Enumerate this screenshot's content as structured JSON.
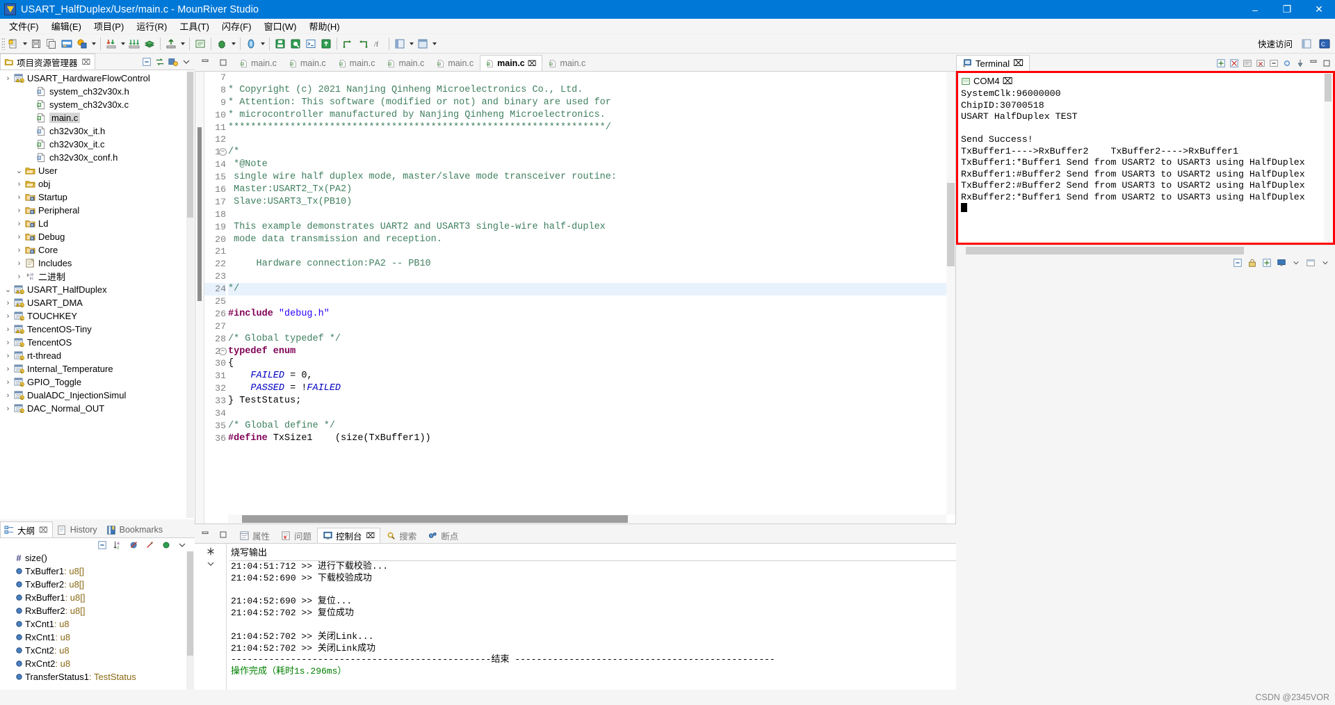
{
  "window": {
    "title": "USART_HalfDuplex/User/main.c - MounRiver Studio",
    "minimize": "–",
    "maximize": "❐",
    "close": "✕"
  },
  "menubar": {
    "items": [
      "文件(F)",
      "编辑(E)",
      "项目(P)",
      "运行(R)",
      "工具(T)",
      "闪存(F)",
      "窗口(W)",
      "帮助(H)"
    ]
  },
  "toolbar": {
    "quick_access": "快速访问"
  },
  "project_explorer": {
    "tab_label": "项目资源管理器",
    "close": "⌧",
    "tree": [
      {
        "indent": 0,
        "expander": "›",
        "icon": "project-icon",
        "label": "DAC_Normal_OUT",
        "selected": false
      },
      {
        "indent": 0,
        "expander": "›",
        "icon": "project-icon",
        "label": "DualADC_InjectionSimul",
        "selected": false
      },
      {
        "indent": 0,
        "expander": "›",
        "icon": "project-icon",
        "label": "GPIO_Toggle",
        "selected": false
      },
      {
        "indent": 0,
        "expander": "›",
        "icon": "project-icon",
        "label": "Internal_Temperature",
        "selected": false
      },
      {
        "indent": 0,
        "expander": "›",
        "icon": "project-icon",
        "label": "rt-thread",
        "selected": false
      },
      {
        "indent": 0,
        "expander": "›",
        "icon": "project-icon",
        "label": "TencentOS",
        "selected": false
      },
      {
        "indent": 0,
        "expander": "›",
        "icon": "project-warn-icon",
        "label": "TencentOS-Tiny",
        "selected": false
      },
      {
        "indent": 0,
        "expander": "›",
        "icon": "project-icon",
        "label": "TOUCHKEY",
        "selected": false
      },
      {
        "indent": 0,
        "expander": "›",
        "icon": "project-warn-icon",
        "label": "USART_DMA",
        "selected": false
      },
      {
        "indent": 0,
        "expander": "⌄",
        "icon": "project-warn-icon",
        "label": "USART_HalfDuplex",
        "selected": false
      },
      {
        "indent": 1,
        "expander": "›",
        "icon": "binaries-icon",
        "label": "二进制",
        "selected": false
      },
      {
        "indent": 1,
        "expander": "›",
        "icon": "includes-icon",
        "label": "Includes",
        "selected": false
      },
      {
        "indent": 1,
        "expander": "›",
        "icon": "srcfolder-icon",
        "label": "Core",
        "selected": false
      },
      {
        "indent": 1,
        "expander": "›",
        "icon": "srcfolder-icon",
        "label": "Debug",
        "selected": false
      },
      {
        "indent": 1,
        "expander": "›",
        "icon": "srcfolder-icon",
        "label": "Ld",
        "selected": false
      },
      {
        "indent": 1,
        "expander": "›",
        "icon": "srcfolder-icon",
        "label": "Peripheral",
        "selected": false
      },
      {
        "indent": 1,
        "expander": "›",
        "icon": "srcfolder-icon",
        "label": "Startup",
        "selected": false
      },
      {
        "indent": 1,
        "expander": "›",
        "icon": "folder-icon",
        "label": "obj",
        "selected": false
      },
      {
        "indent": 1,
        "expander": "⌄",
        "icon": "folder-icon",
        "label": "User",
        "selected": false
      },
      {
        "indent": 2,
        "expander": "",
        "icon": "header-file-icon",
        "label": "ch32v30x_conf.h",
        "selected": false
      },
      {
        "indent": 2,
        "expander": "",
        "icon": "c-file-icon",
        "label": "ch32v30x_it.c",
        "selected": false
      },
      {
        "indent": 2,
        "expander": "",
        "icon": "header-file-icon",
        "label": "ch32v30x_it.h",
        "selected": false
      },
      {
        "indent": 2,
        "expander": "",
        "icon": "c-file-icon",
        "label": "main.c",
        "selected": true
      },
      {
        "indent": 2,
        "expander": "",
        "icon": "c-file-icon",
        "label": "system_ch32v30x.c",
        "selected": false
      },
      {
        "indent": 2,
        "expander": "",
        "icon": "header-file-icon",
        "label": "system_ch32v30x.h",
        "selected": false
      },
      {
        "indent": 0,
        "expander": "›",
        "icon": "project-warn-icon",
        "label": "USART_HardwareFlowControl",
        "selected": false
      }
    ]
  },
  "outline": {
    "tabs": [
      {
        "label": "大纲",
        "active": true,
        "icon": "outline-icon"
      },
      {
        "label": "History",
        "active": false,
        "icon": "history-icon"
      },
      {
        "label": "Bookmarks",
        "active": false,
        "icon": "bookmark-icon"
      }
    ],
    "close": "⌧",
    "items": [
      {
        "icon": "define-icon",
        "name": "size()",
        "type": ""
      },
      {
        "icon": "var-icon",
        "name": "TxBuffer1",
        "type": " : u8[]"
      },
      {
        "icon": "var-icon",
        "name": "TxBuffer2",
        "type": " : u8[]"
      },
      {
        "icon": "var-icon",
        "name": "RxBuffer1",
        "type": " : u8[]"
      },
      {
        "icon": "var-icon",
        "name": "RxBuffer2",
        "type": " : u8[]"
      },
      {
        "icon": "var-icon",
        "name": "TxCnt1",
        "type": " : u8"
      },
      {
        "icon": "var-icon",
        "name": "RxCnt1",
        "type": " : u8"
      },
      {
        "icon": "var-icon",
        "name": "TxCnt2",
        "type": " : u8"
      },
      {
        "icon": "var-icon",
        "name": "RxCnt2",
        "type": " : u8"
      },
      {
        "icon": "var-icon",
        "name": "TransferStatus1",
        "type": " : TestStatus"
      }
    ]
  },
  "editor": {
    "tabs": [
      {
        "label": "main.c",
        "active": false
      },
      {
        "label": "main.c",
        "active": false
      },
      {
        "label": "main.c",
        "active": false
      },
      {
        "label": "main.c",
        "active": false
      },
      {
        "label": "main.c",
        "active": false
      },
      {
        "label": "main.c",
        "active": true
      },
      {
        "label": "main.c",
        "active": false
      }
    ],
    "active_tab_close": "⌧",
    "lines": [
      {
        "num": 7,
        "fold": "",
        "highlight": false,
        "tokens": [
          {
            "t": " ",
            "c": "pl"
          }
        ]
      },
      {
        "num": 8,
        "fold": "",
        "highlight": false,
        "tokens": [
          {
            "t": "* Copyright (c) 2021 Nanjing Qinheng Microelectronics Co., Ltd.",
            "c": "cmt"
          }
        ]
      },
      {
        "num": 9,
        "fold": "",
        "highlight": false,
        "tokens": [
          {
            "t": "* Attention: This software (modified or not) and binary are used for",
            "c": "cmt"
          }
        ]
      },
      {
        "num": 10,
        "fold": "",
        "highlight": false,
        "tokens": [
          {
            "t": "* microcontroller manufactured by Nanjing Qinheng Microelectronics.",
            "c": "cmt"
          }
        ]
      },
      {
        "num": 11,
        "fold": "",
        "highlight": false,
        "tokens": [
          {
            "t": "*******************************************************************/",
            "c": "cmt"
          }
        ]
      },
      {
        "num": 12,
        "fold": "",
        "highlight": false,
        "tokens": [
          {
            "t": "",
            "c": "pl"
          }
        ]
      },
      {
        "num": 13,
        "fold": "⊖",
        "highlight": false,
        "tokens": [
          {
            "t": "/*",
            "c": "cmt"
          }
        ]
      },
      {
        "num": 14,
        "fold": "",
        "highlight": false,
        "tokens": [
          {
            "t": " *@Note",
            "c": "cmt"
          }
        ]
      },
      {
        "num": 15,
        "fold": "",
        "highlight": false,
        "tokens": [
          {
            "t": " single wire half duplex mode, master/slave mode transceiver routine:",
            "c": "cmt"
          }
        ]
      },
      {
        "num": 16,
        "fold": "",
        "highlight": false,
        "tokens": [
          {
            "t": " Master:USART2_Tx(PA2)",
            "c": "cmt"
          }
        ]
      },
      {
        "num": 17,
        "fold": "",
        "highlight": false,
        "tokens": [
          {
            "t": " Slave:USART3_Tx(PB10)",
            "c": "cmt"
          }
        ]
      },
      {
        "num": 18,
        "fold": "",
        "highlight": false,
        "tokens": [
          {
            "t": "",
            "c": "pl"
          }
        ]
      },
      {
        "num": 19,
        "fold": "",
        "highlight": false,
        "tokens": [
          {
            "t": " This example demonstrates UART2 and USART3 single-wire half-duplex",
            "c": "cmt"
          }
        ]
      },
      {
        "num": 20,
        "fold": "",
        "highlight": false,
        "tokens": [
          {
            "t": " mode data transmission and reception.",
            "c": "cmt"
          }
        ]
      },
      {
        "num": 21,
        "fold": "",
        "highlight": false,
        "tokens": [
          {
            "t": "",
            "c": "pl"
          }
        ]
      },
      {
        "num": 22,
        "fold": "",
        "highlight": false,
        "tokens": [
          {
            "t": "     Hardware connection:PA2 -- PB10",
            "c": "cmt"
          }
        ]
      },
      {
        "num": 23,
        "fold": "",
        "highlight": false,
        "tokens": [
          {
            "t": "",
            "c": "pl"
          }
        ]
      },
      {
        "num": 24,
        "fold": "",
        "highlight": true,
        "tokens": [
          {
            "t": "*/",
            "c": "cmt"
          }
        ]
      },
      {
        "num": 25,
        "fold": "",
        "highlight": false,
        "tokens": [
          {
            "t": "",
            "c": "pl"
          }
        ]
      },
      {
        "num": 26,
        "fold": "",
        "highlight": false,
        "tokens": [
          {
            "t": "#include ",
            "c": "pre"
          },
          {
            "t": "\"debug.h\"",
            "c": "str"
          }
        ]
      },
      {
        "num": 27,
        "fold": "",
        "highlight": false,
        "tokens": [
          {
            "t": "",
            "c": "pl"
          }
        ]
      },
      {
        "num": 28,
        "fold": "",
        "highlight": false,
        "tokens": [
          {
            "t": "/* Global typedef */",
            "c": "cmt"
          }
        ]
      },
      {
        "num": 29,
        "fold": "⊖",
        "highlight": false,
        "tokens": [
          {
            "t": "typedef enum",
            "c": "kw"
          }
        ]
      },
      {
        "num": 30,
        "fold": "",
        "highlight": false,
        "tokens": [
          {
            "t": "{",
            "c": "pl"
          }
        ]
      },
      {
        "num": 31,
        "fold": "",
        "highlight": false,
        "tokens": [
          {
            "t": "    ",
            "c": "pl"
          },
          {
            "t": "FAILED",
            "c": "en"
          },
          {
            "t": " = 0,",
            "c": "pl"
          }
        ]
      },
      {
        "num": 32,
        "fold": "",
        "highlight": false,
        "tokens": [
          {
            "t": "    ",
            "c": "pl"
          },
          {
            "t": "PASSED",
            "c": "en"
          },
          {
            "t": " = !",
            "c": "pl"
          },
          {
            "t": "FAILED",
            "c": "en"
          }
        ]
      },
      {
        "num": 33,
        "fold": "",
        "highlight": false,
        "tokens": [
          {
            "t": "} TestStatus;",
            "c": "pl"
          }
        ]
      },
      {
        "num": 34,
        "fold": "",
        "highlight": false,
        "tokens": [
          {
            "t": "",
            "c": "pl"
          }
        ]
      },
      {
        "num": 35,
        "fold": "",
        "highlight": false,
        "tokens": [
          {
            "t": "/* Global define */",
            "c": "cmt"
          }
        ]
      },
      {
        "num": 36,
        "fold": "",
        "highlight": false,
        "tokens": [
          {
            "t": "#define ",
            "c": "pre"
          },
          {
            "t": "TxSize1    (size(TxBuffer1))",
            "c": "pl"
          }
        ]
      }
    ]
  },
  "console": {
    "tabs": [
      {
        "label": "属性",
        "active": false,
        "icon": "properties-icon"
      },
      {
        "label": "问题",
        "active": false,
        "icon": "problems-icon"
      },
      {
        "label": "控制台",
        "active": true,
        "icon": "console-icon"
      },
      {
        "label": "搜索",
        "active": false,
        "icon": "search-icon"
      },
      {
        "label": "断点",
        "active": false,
        "icon": "breakpoint-icon"
      }
    ],
    "active_close": "⌧",
    "header": "烧写输出",
    "lines": [
      {
        "text": "21:04:51:712 >> 进行下载校验...",
        "green": false
      },
      {
        "text": "21:04:52:690 >> 下载校验成功",
        "green": false
      },
      {
        "text": "",
        "green": false
      },
      {
        "text": "21:04:52:690 >> 复位...",
        "green": false
      },
      {
        "text": "21:04:52:702 >> 复位成功",
        "green": false
      },
      {
        "text": "",
        "green": false
      },
      {
        "text": "21:04:52:702 >> 关闭Link...",
        "green": false
      },
      {
        "text": "21:04:52:702 >> 关闭Link成功",
        "green": false
      },
      {
        "text": "------------------------------------------------结束 ------------------------------------------------",
        "green": false
      },
      {
        "text": "操作完成（耗时1s.296ms）",
        "green": true
      }
    ]
  },
  "terminal": {
    "tab_label": "Terminal",
    "tab_close": "⌧",
    "connection_tab": "COM4",
    "connection_close": "⌧",
    "border_color": "#ff0000",
    "lines": [
      "SystemClk:96000000",
      "ChipID:30700518",
      "USART HalfDuplex TEST",
      "",
      "Send Success!",
      "TxBuffer1---->RxBuffer2    TxBuffer2---->RxBuffer1",
      "TxBuffer1:*Buffer1 Send from USART2 to USART3 using HalfDuplex",
      "RxBuffer1:#Buffer2 Send from USART3 to USART2 using HalfDuplex",
      "TxBuffer2:#Buffer2 Send from USART3 to USART2 using HalfDuplex",
      "RxBuffer2:*Buffer1 Send from USART2 to USART3 using HalfDuplex"
    ]
  },
  "statusbar": {
    "watermark": "CSDN @2345VOR"
  }
}
